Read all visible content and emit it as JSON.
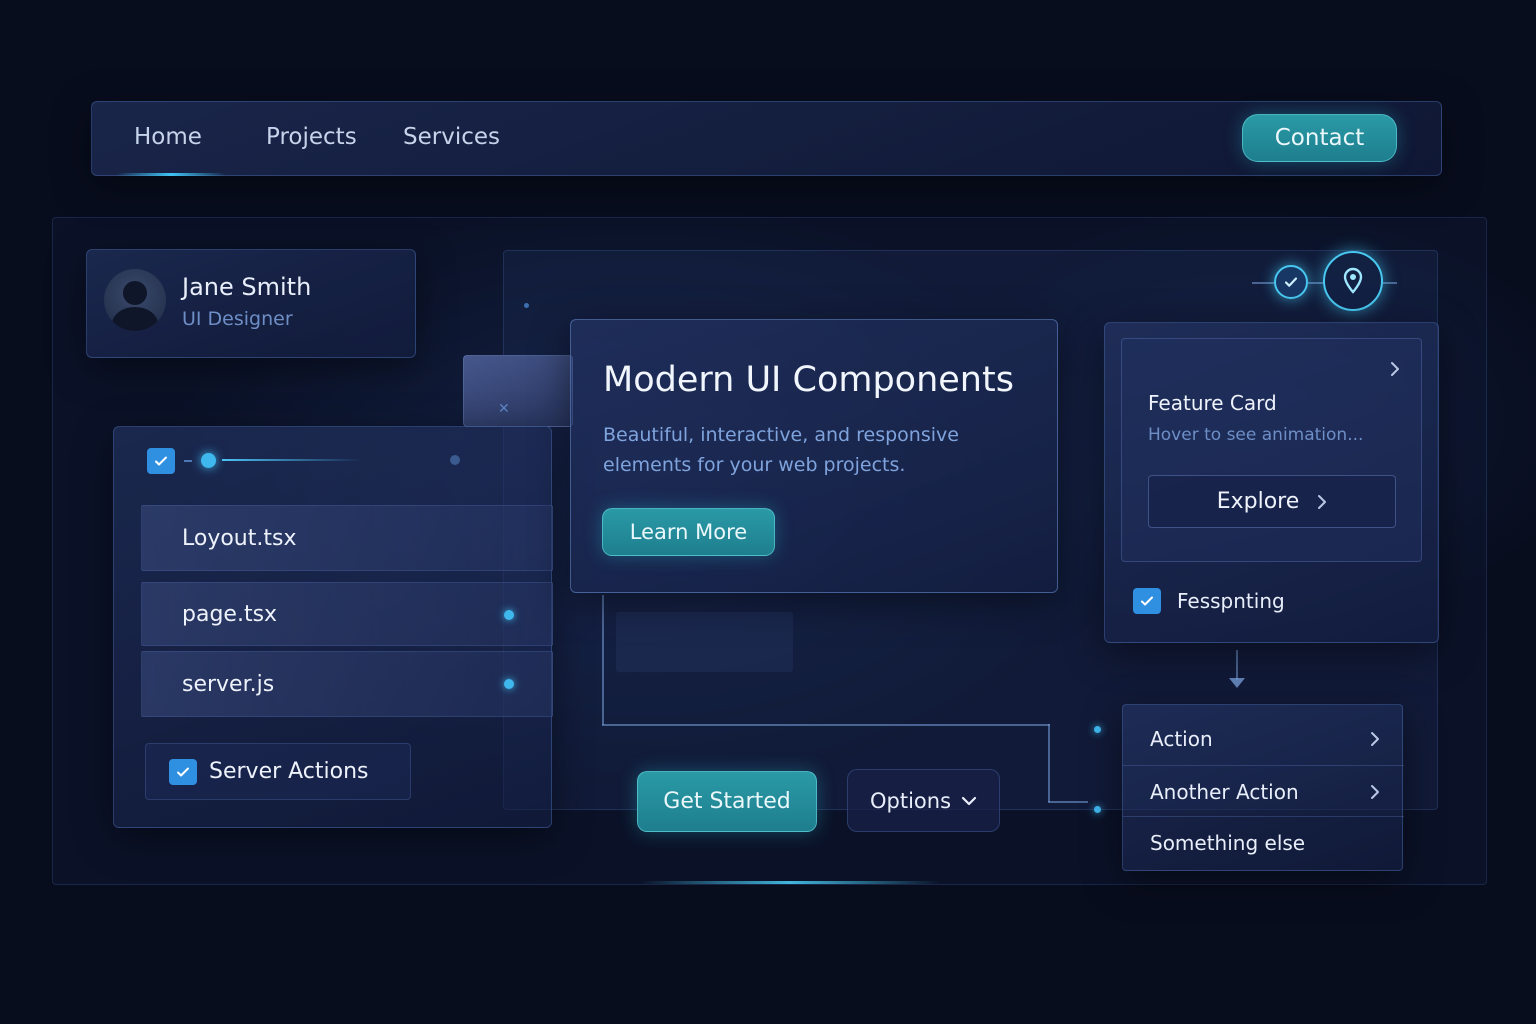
{
  "nav": {
    "links": [
      "Home",
      "Projects",
      "Services"
    ],
    "contact_label": "Contact"
  },
  "profile": {
    "name": "Jane Smith",
    "role": "UI Designer"
  },
  "files": {
    "items": [
      "Loyout.tsx",
      "page.tsx",
      "server.js"
    ],
    "server_actions_label": "Server Actions"
  },
  "hero": {
    "title": "Modern UI Components",
    "description": "Beautiful, interactive, and responsive elements for your web projects.",
    "cta_label": "Learn More"
  },
  "actions": {
    "get_started_label": "Get Started",
    "options_label": "Options"
  },
  "feature": {
    "title": "Feature Card",
    "subtitle": "Hover to see animation...",
    "explore_label": "Explore",
    "checkbox_label": "Fesspnting"
  },
  "menu": {
    "items": [
      "Action",
      "Another Action",
      "Something else"
    ]
  },
  "colors": {
    "background": "#080d1e",
    "accent_teal": "#1e7e8e",
    "accent_glow": "#3fc3f4",
    "checkbox": "#2f8fe0",
    "secondary_text": "#6e8ec6"
  },
  "icons": [
    "avatar-icon",
    "checkbox-check-icon",
    "chevron-right-icon",
    "chevron-down-icon",
    "check-circle-icon",
    "location-pin-icon"
  ]
}
